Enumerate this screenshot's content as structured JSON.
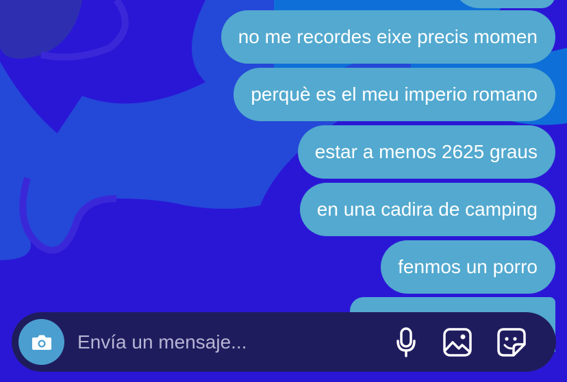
{
  "colors": {
    "background": "#2a17d6",
    "bubble": "#53a9cf",
    "composer": "#1f1c5e",
    "camera_button": "#4b9fd0"
  },
  "messages": [
    {
      "text": "no me recordes eixe precis momen"
    },
    {
      "text": "perquè es el meu imperio romano"
    },
    {
      "text": "estar a menos 2625 graus"
    },
    {
      "text": "en una cadira de camping"
    },
    {
      "text": "fenmos un porro"
    }
  ],
  "composer": {
    "placeholder": "Envía un mensaje...",
    "icons": [
      "camera-icon",
      "microphone-icon",
      "image-icon",
      "sticker-icon"
    ]
  }
}
